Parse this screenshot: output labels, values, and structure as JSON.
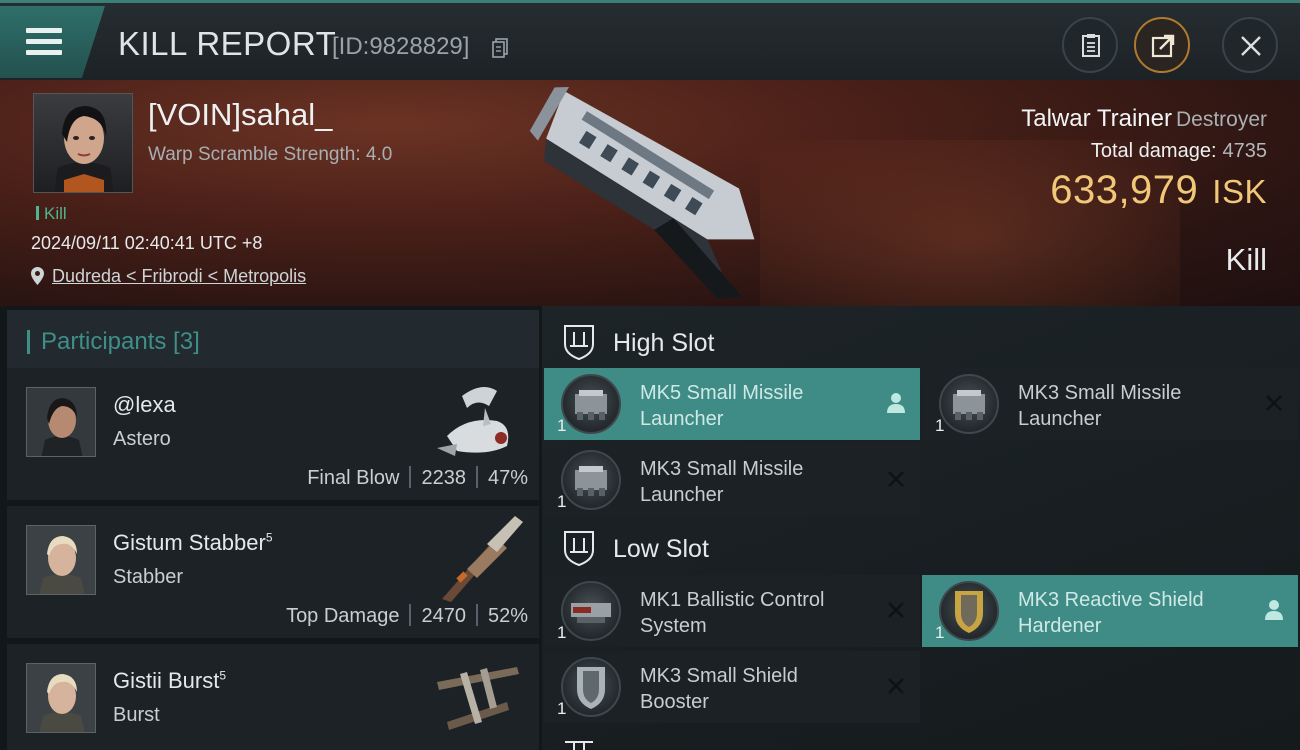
{
  "header": {
    "title": "KILL REPORT",
    "report_id": "[ID:9828829]",
    "icons": [
      "menu-icon",
      "copy-icon",
      "clipboard-icon",
      "share-icon",
      "close-icon"
    ]
  },
  "victim": {
    "pilot_name": "[VOIN]sahal_",
    "warp_scramble": "Warp Scramble Strength: 4.0",
    "tag": "Kill",
    "datetime": "2024/09/11 02:40:41 UTC +8",
    "location": "Dudreda < Fribrodi < Metropolis",
    "ship_name": "Talwar Trainer",
    "ship_class": "Destroyer",
    "total_damage_label": "Total damage:",
    "total_damage": "4735",
    "isk_value": "633,979",
    "isk_unit": "ISK",
    "result": "Kill"
  },
  "participants": {
    "header": "Participants [3]",
    "items": [
      {
        "name": "@lexa",
        "ship": "Astero",
        "role": "Final Blow",
        "damage": "2238",
        "percent": "47%"
      },
      {
        "name": "Gistum Stabber",
        "sup": "5",
        "ship": "Stabber",
        "role": "Top Damage",
        "damage": "2470",
        "percent": "52%"
      },
      {
        "name": "Gistii Burst",
        "sup": "5",
        "ship": "Burst"
      }
    ]
  },
  "slots": {
    "high": {
      "label": "High Slot",
      "modules": [
        {
          "name": "MK5 Small Missile Launcher",
          "qty": "1",
          "status": "person"
        },
        {
          "name": "MK3 Small Missile Launcher",
          "qty": "1",
          "status": "destroyed"
        },
        {
          "name": "MK3 Small Missile Launcher",
          "qty": "1",
          "status": "destroyed"
        }
      ]
    },
    "low": {
      "label": "Low Slot",
      "modules": [
        {
          "name": "MK1 Ballistic Control System",
          "qty": "1",
          "status": "destroyed"
        },
        {
          "name": "MK3 Reactive Shield Hardener",
          "qty": "1",
          "status": "person"
        },
        {
          "name": "MK3 Small Shield Booster",
          "qty": "1",
          "status": "destroyed"
        }
      ]
    }
  },
  "colors": {
    "accent": "#3f8c86",
    "isk": "#f0c878",
    "kill_tag": "#4fb58e"
  }
}
